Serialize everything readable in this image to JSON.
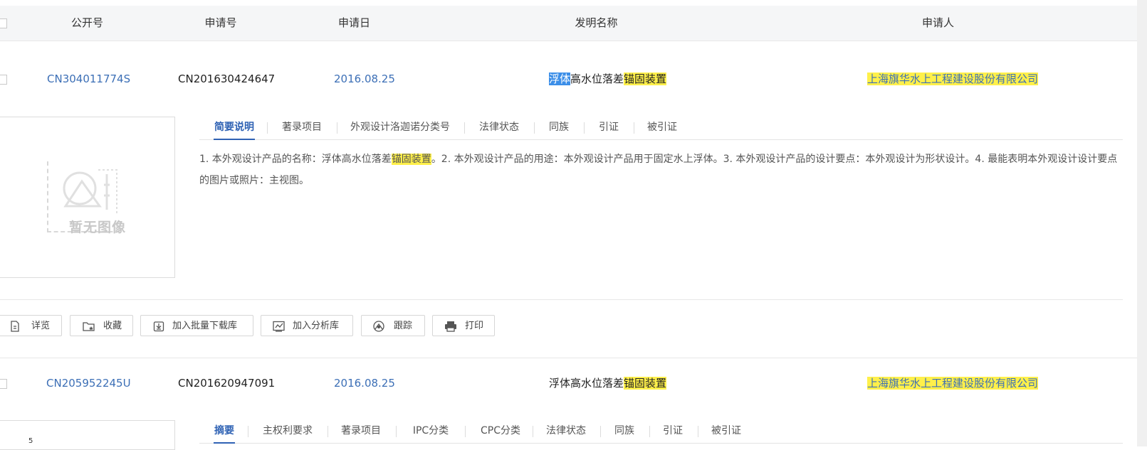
{
  "columns": [
    "公开号",
    "申请号",
    "申请日",
    "发明名称",
    "申请人"
  ],
  "records": [
    {
      "pub_no": "CN304011774S",
      "app_no": "CN201630424647",
      "app_date": "2016.08.25",
      "title_sel": "浮体",
      "title_mid": "高水位落差",
      "title_hl": "锚固装置",
      "applicant": "上海旗华水上工程建设股份有限公司",
      "no_image_text": "暂无图像",
      "tabs": [
        "简要说明",
        "著录项目",
        "外观设计洛迦诺分类号",
        "法律状态",
        "同族",
        "引证",
        "被引证"
      ],
      "desc_a": "1. 本外观设计产品的名称：浮体高水位落差",
      "desc_hl": "锚固装置",
      "desc_b": "。2. 本外观设计产品的用途：本外观设计产品用于固定水上浮体。3. 本外观设计产品的设计要点：本外观设计为形状设计。4. 最能表明本外观设计设计要点的图片或照片：主视图。"
    },
    {
      "pub_no": "CN205952245U",
      "app_no": "CN201620947091",
      "app_date": "2016.08.25",
      "title_plain": "浮体高水位落差",
      "title_hl": "锚固装置",
      "applicant": "上海旗华水上工程建设股份有限公司",
      "tabs": [
        "摘要",
        "主权利要求",
        "著录项目",
        "IPC分类",
        "CPC分类",
        "法律状态",
        "同族",
        "引证",
        "被引证"
      ],
      "thumb_mark": "5"
    }
  ],
  "actions": [
    {
      "label": "详览",
      "icon": "document-icon"
    },
    {
      "label": "收藏",
      "icon": "folder-star-icon"
    },
    {
      "label": "加入批量下载库",
      "icon": "download-icon"
    },
    {
      "label": "加入分析库",
      "icon": "chart-icon"
    },
    {
      "label": "跟踪",
      "icon": "radar-icon"
    },
    {
      "label": "打印",
      "icon": "printer-icon"
    }
  ],
  "colors": {
    "link": "#3c6fb6",
    "highlight": "#fff04a",
    "selection": "#3b8ee8",
    "active_tab": "#2f62b4"
  }
}
